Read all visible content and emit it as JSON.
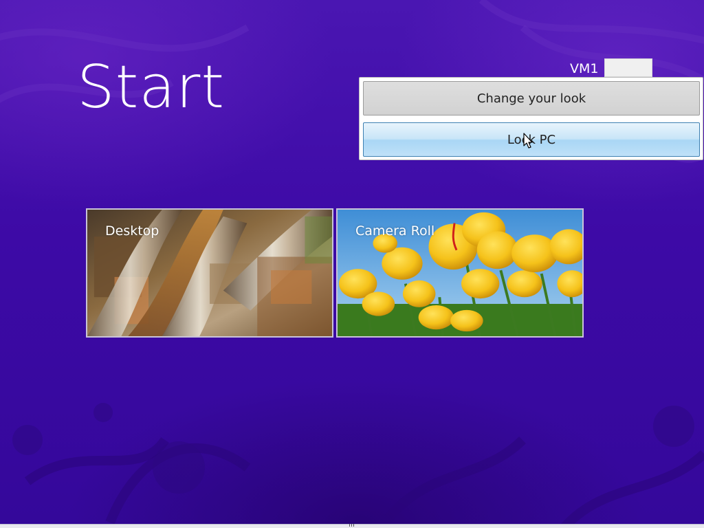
{
  "screen": {
    "title": "Start"
  },
  "user": {
    "name": "VM1"
  },
  "user_menu": {
    "change_look_label": "Change your look",
    "lock_pc_label": "Lock PC"
  },
  "tiles": [
    {
      "label": "Desktop",
      "icon": "desktop-wallpaper-art"
    },
    {
      "label": "Camera Roll",
      "icon": "yellow-tulips-photo"
    }
  ],
  "colors": {
    "background": "#3d0aa6",
    "title_text": "#ffffff",
    "lock_button_accent": "#a9d6f5",
    "change_button_bg": "#d2d2d2"
  }
}
